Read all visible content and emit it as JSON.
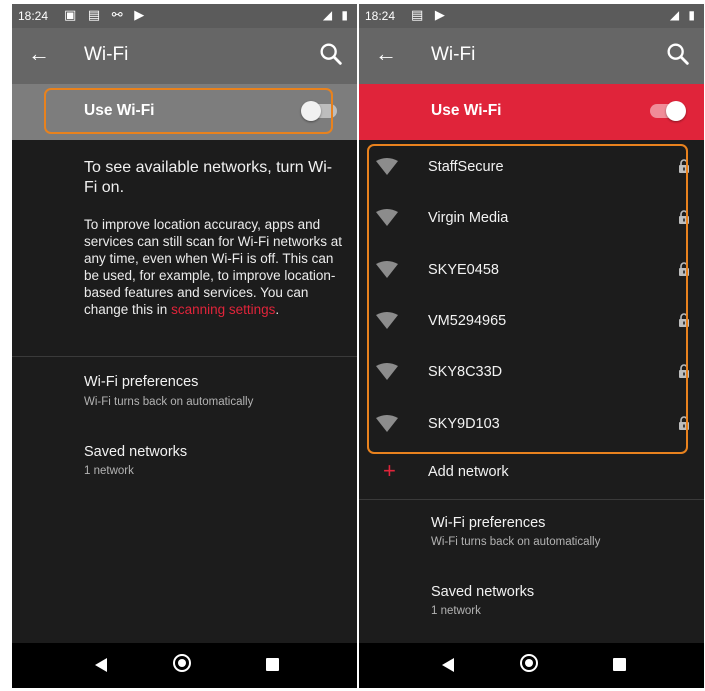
{
  "status_bar": {
    "time": "18:24",
    "left_icons_left": "▣ ▤ ⚯ ▶",
    "left_icons_right": "▤ ▶",
    "right_icons": "◢ ▮"
  },
  "app_bar": {
    "title": "Wi-Fi"
  },
  "toggle": {
    "label": "Use Wi-Fi"
  },
  "wifi_off": {
    "title": "To see available networks, turn Wi-Fi on.",
    "body": "To improve location accuracy, apps and services can still scan for Wi-Fi networks at any time, even when Wi-Fi is off. This can be used, for example, to improve location-based features and services. You can change this in ",
    "link": "scanning settings",
    "period": "."
  },
  "networks": [
    "StaffSecure",
    "Virgin Media",
    "SKYE0458",
    "VM5294965",
    "SKY8C33D",
    "SKY9D103"
  ],
  "add_network": {
    "icon": "+",
    "label": "Add network"
  },
  "preferences": {
    "title": "Wi-Fi preferences",
    "subtitle": "Wi-Fi turns back on automatically"
  },
  "saved": {
    "title": "Saved networks",
    "subtitle": "1 network"
  },
  "colors": {
    "accent": "#e0243a",
    "highlight": "#e8821e",
    "background": "#1c1c1c",
    "app_bar": "#666666"
  },
  "icons": {
    "back": "arrow-left-icon",
    "search": "search-icon",
    "wifi": "wifi-signal-icon",
    "lock": "lock-icon",
    "nav_back": "nav-back-icon",
    "nav_home": "nav-home-icon",
    "nav_recent": "nav-recent-icon"
  }
}
